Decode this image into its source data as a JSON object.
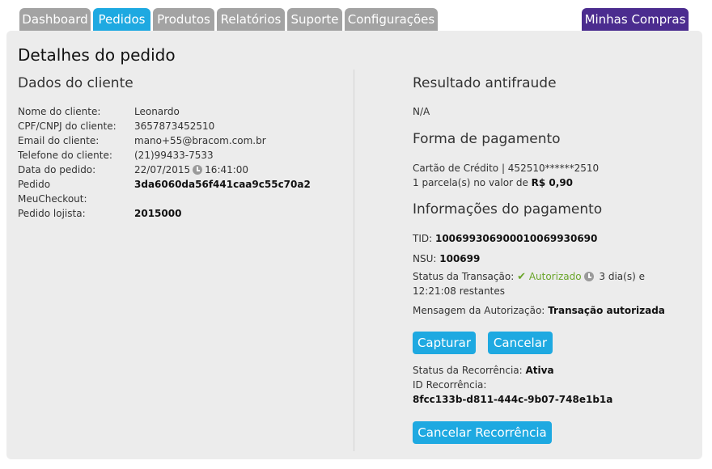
{
  "tabs": [
    {
      "label": "Dashboard"
    },
    {
      "label": "Pedidos"
    },
    {
      "label": "Produtos"
    },
    {
      "label": "Relatórios"
    },
    {
      "label": "Suporte"
    },
    {
      "label": "Configurações"
    }
  ],
  "top_right_tab": "Minhas Compras",
  "page_title": "Detalhes do pedido",
  "cliente": {
    "section_title": "Dados do cliente",
    "fields": [
      {
        "label": "Nome do cliente:",
        "value": "Leonardo"
      },
      {
        "label": "CPF/CNPJ do cliente:",
        "value": "3657873452510"
      },
      {
        "label": "Email do cliente:",
        "value": "mano+55@bracom.com.br"
      },
      {
        "label": "Telefone do cliente:",
        "value": "(21)99433-7533"
      },
      {
        "label": "Data do pedido:",
        "date": "22/07/2015",
        "time": "16:41:00"
      },
      {
        "label_line1": "Pedido",
        "label_line2": "MeuCheckout:",
        "value": "3da6060da56f441caa9c55c70a2"
      },
      {
        "label": "Pedido lojista:",
        "value": "2015000"
      }
    ]
  },
  "antifraude": {
    "section_title": "Resultado antifraude",
    "value": "N/A"
  },
  "pagamento": {
    "section_title": "Forma de pagamento",
    "card_line": "Cartão de Crédito | 452510******2510",
    "installments_text": "1 parcela(s) no valor de",
    "installments_value": "R$ 0,90"
  },
  "info_pagamento": {
    "section_title": "Informações do pagamento",
    "tid_label": "TID:",
    "tid_value": "1006993069000100699306​90",
    "nsu_label": "NSU:",
    "nsu_value": "100699",
    "status_label": "Status da Transação:",
    "status_value": "Autorizado",
    "remaining_line1": "3 dia(s) e",
    "remaining_line2": "12:21:08 restantes",
    "msg_label": "Mensagem da Autorização:",
    "msg_value": "Transação autorizada"
  },
  "buttons": {
    "capturar": "Capturar",
    "cancelar": "Cancelar",
    "cancelar_recorrencia": "Cancelar Recorrência"
  },
  "recorrencia": {
    "status_label": "Status da Recorrência:",
    "status_value": "Ativa",
    "id_label": "ID Recorrência:",
    "id_value": "8fcc133b-d811-444c-9b07-748e1b1a"
  },
  "colors": {
    "active_tab": "#1ea9e1",
    "inactive_tab": "#a3a3a3",
    "purple_tab": "#4b2c8f",
    "success": "#6aa52a"
  }
}
